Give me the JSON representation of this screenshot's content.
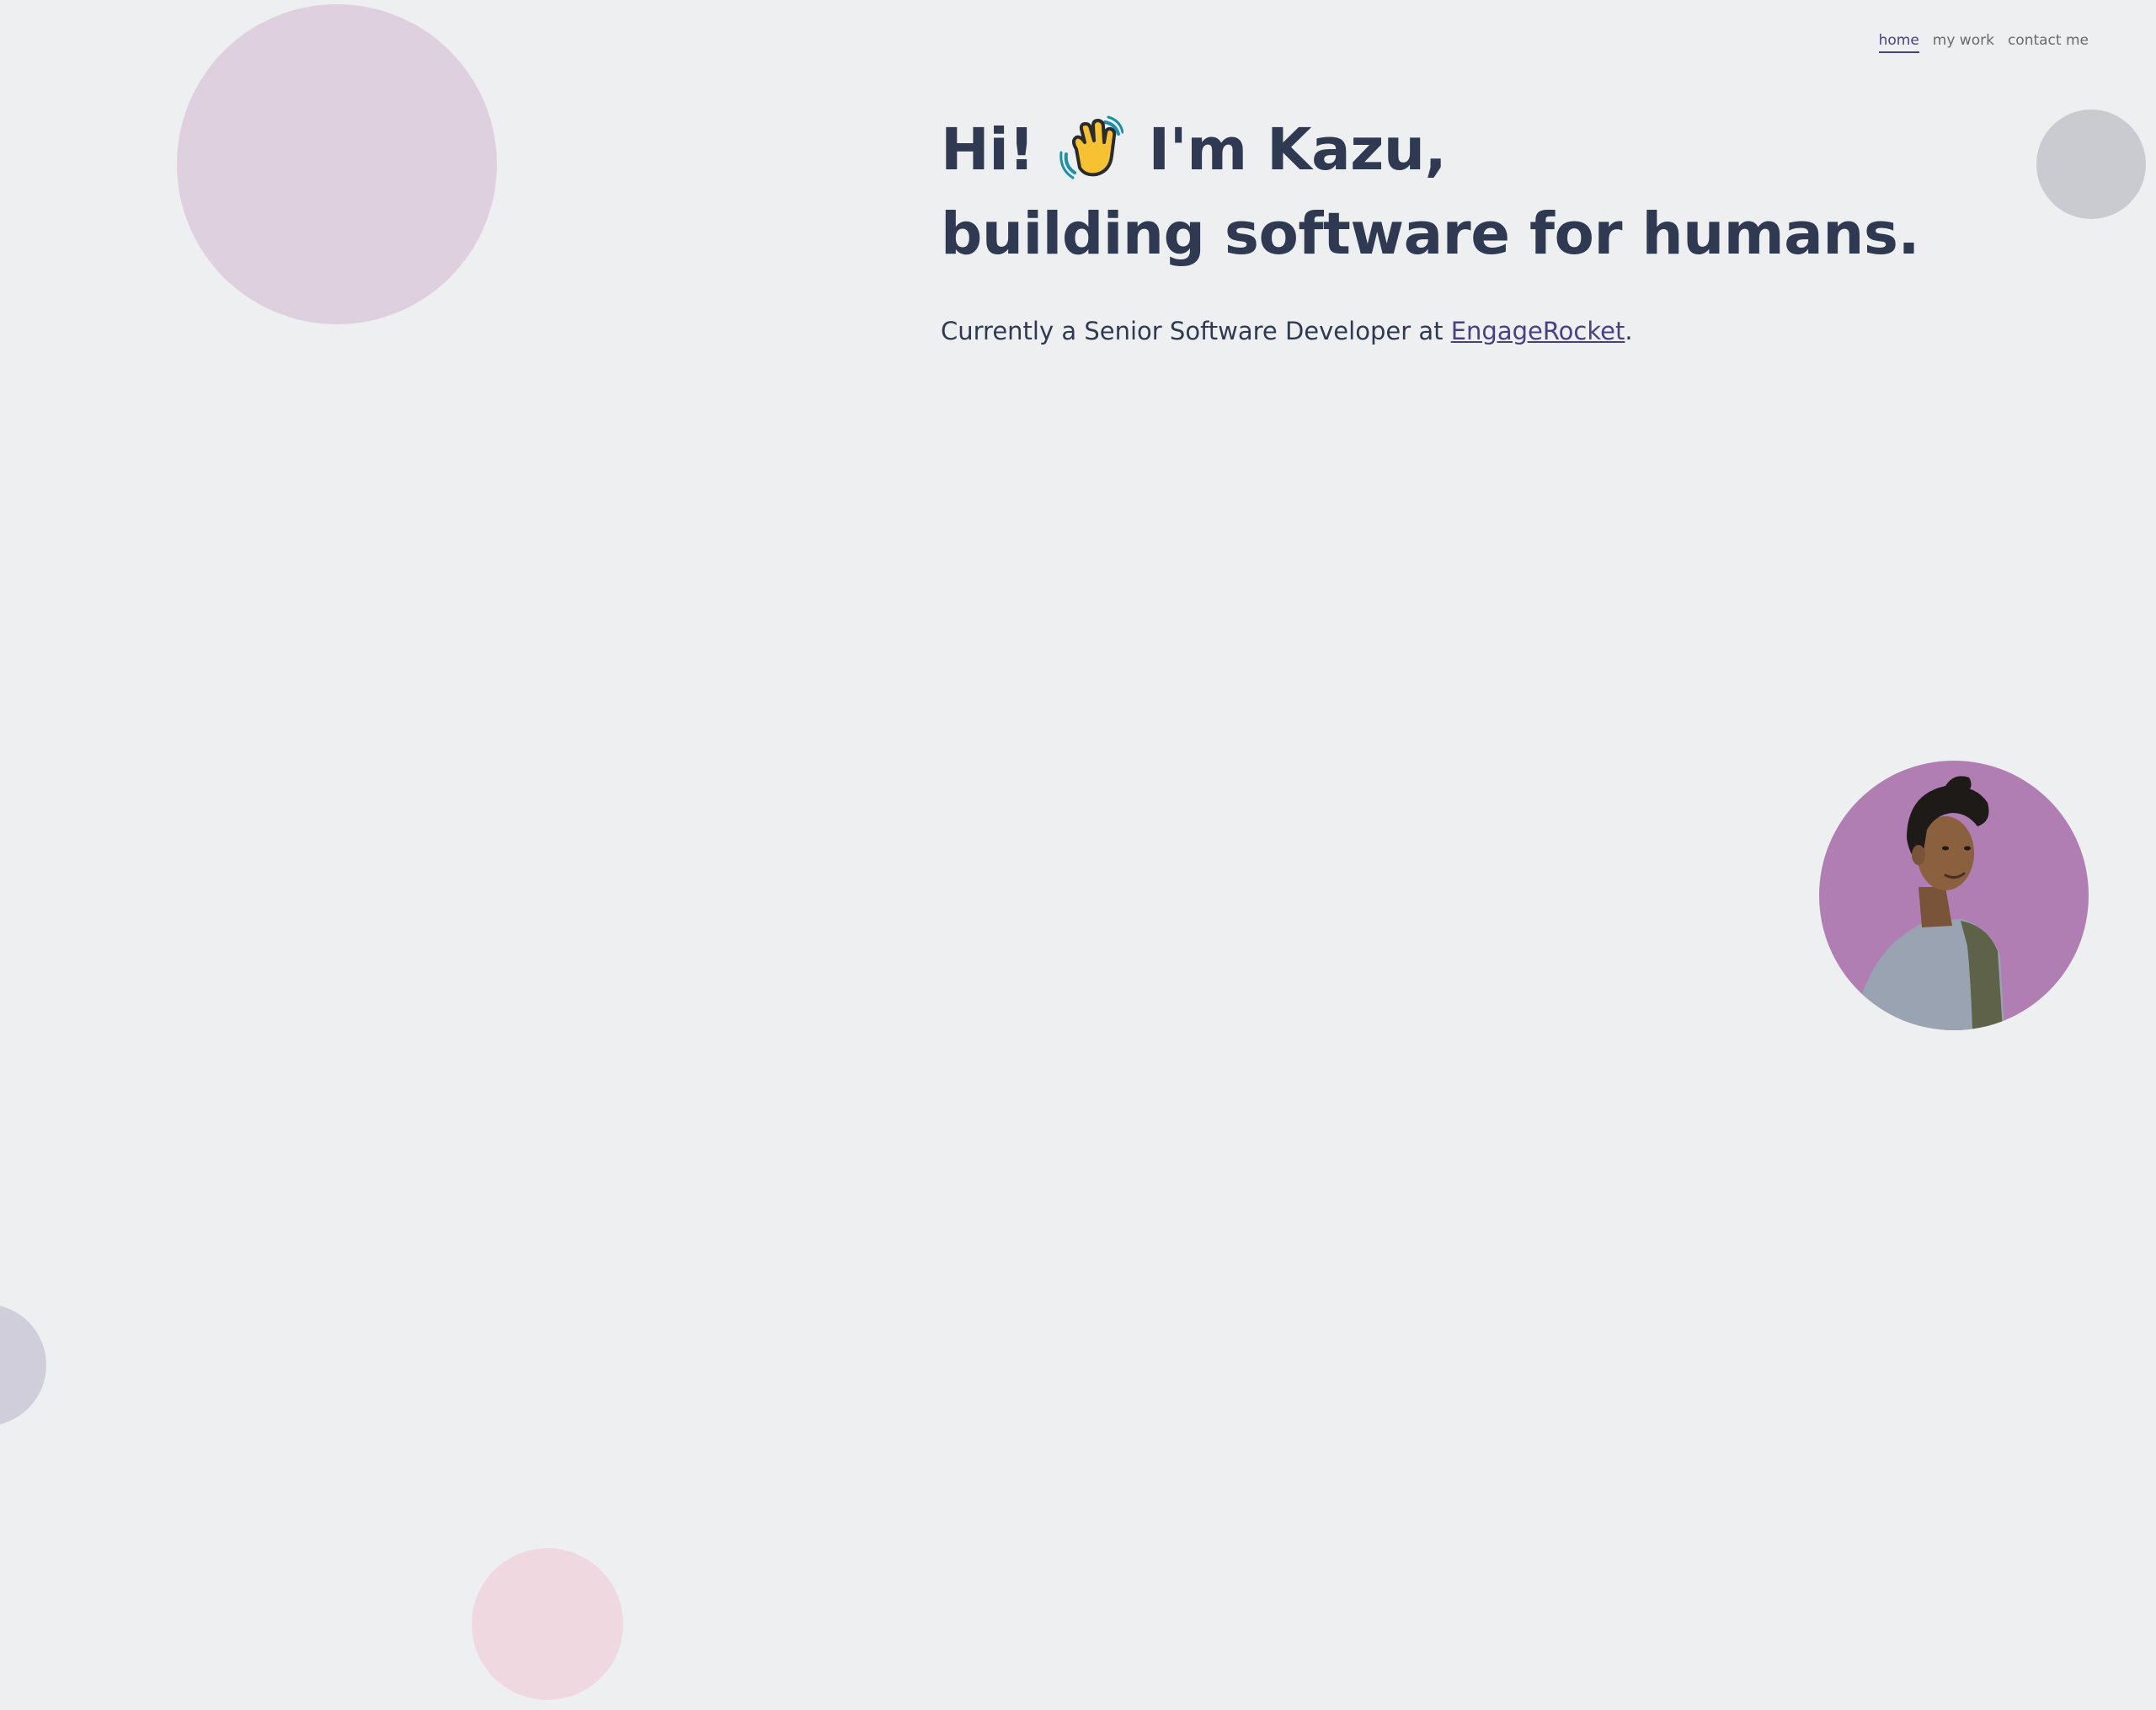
{
  "nav": {
    "items": [
      {
        "label": "home",
        "active": true
      },
      {
        "label": "my work",
        "active": false
      },
      {
        "label": "contact me",
        "active": false
      }
    ]
  },
  "hero": {
    "greeting": "Hi!",
    "wave_icon": "waving-hand-icon",
    "intro": "I'm Kazu,",
    "headline_line2": "building software for humans.",
    "tagline_prefix": "Currently a Senior Software Developer at ",
    "company_link": "EngageRocket",
    "tagline_suffix": "."
  },
  "avatar": {
    "icon": "profile-photo",
    "background_color": "#b07eb2"
  },
  "colors": {
    "background": "#eeeff1",
    "heading": "#2f3a52",
    "accent": "#4a3f85",
    "bubble_pink": "#dfd0df",
    "bubble_grey": "#c9cbd1",
    "bubble_lavender": "#d1cedc",
    "bubble_rose": "#f0d8e1"
  }
}
